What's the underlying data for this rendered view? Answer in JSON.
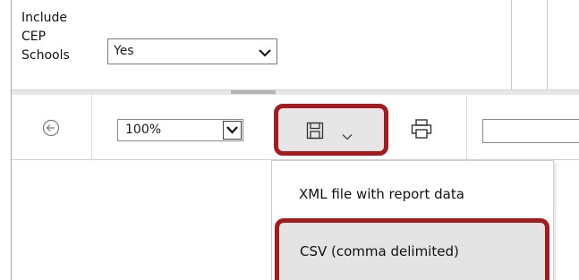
{
  "parameters": {
    "label": "Include CEP Schools",
    "value": "Yes",
    "icon": "chevron-down-icon"
  },
  "toolbar": {
    "back_icon": "back-arrow-circle-icon",
    "zoom_value": "100%",
    "zoom_dropdown_icon": "dropdown-arrow-icon",
    "export_icon": "save-icon",
    "export_chevron_icon": "chevron-down-icon",
    "print_icon": "printer-icon",
    "find_value": ""
  },
  "export_menu": {
    "items": [
      {
        "label": "XML file with report data"
      },
      {
        "label": "CSV (comma delimited)"
      }
    ]
  },
  "colors": {
    "highlight_border": "#a51a1f",
    "hover_bg": "#e4e4e4"
  }
}
